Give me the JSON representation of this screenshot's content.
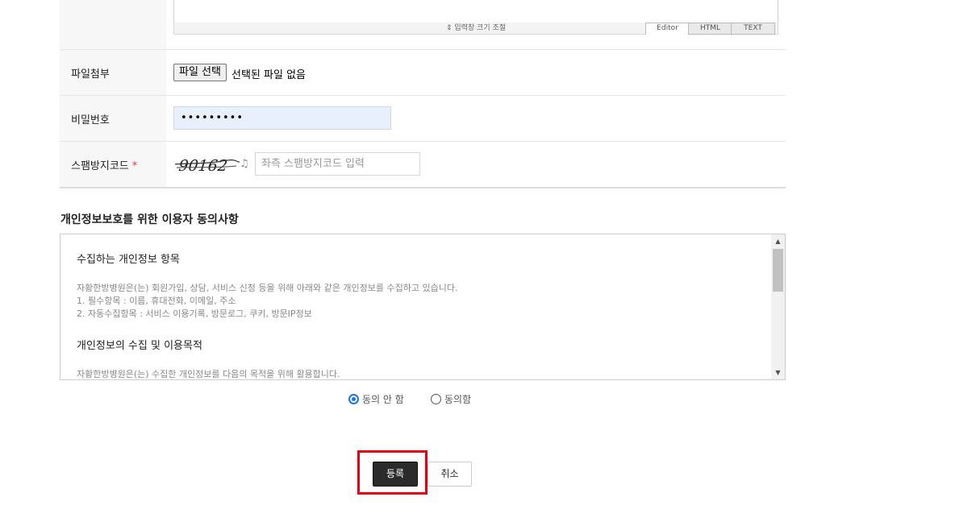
{
  "editor": {
    "resize_label": "⇕ 입력창 크기 조절",
    "tabs": [
      "Editor",
      "HTML",
      "TEXT"
    ]
  },
  "form": {
    "attachment": {
      "label": "파일첨부",
      "button": "파일 선택",
      "status": "선택된 파일 없음"
    },
    "password": {
      "label": "비밀번호",
      "value": "•••••••••"
    },
    "captcha": {
      "label": "스팸방지코드",
      "required_mark": "*",
      "code_image_text": "90162",
      "headset_icon": "♫",
      "placeholder": "좌측 스팸방지코드 입력"
    }
  },
  "privacy": {
    "title": "개인정보보호를 위한 이용자 동의사항",
    "sections": [
      {
        "heading": "수집하는 개인정보 항목",
        "lines": [
          "자황한방병원은(는) 회원가입, 상담, 서비스 신청 등을 위해 아래와 같은 개인정보를 수집하고 있습니다.",
          "1. 필수항목 : 이름, 휴대전화, 이메일, 주소",
          "2. 자동수집항목 : 서비스 이용기록, 방문로그, 쿠키, 방문IP정보"
        ]
      },
      {
        "heading": "개인정보의 수집 및 이용목적",
        "lines": [
          "자황한방병원은(는) 수집한 개인정보를 다음의 목적을 위해 활용합니다."
        ]
      }
    ],
    "options": {
      "disagree": "동의 안 함",
      "agree": "동의함"
    },
    "selected": "disagree"
  },
  "actions": {
    "submit": "등록",
    "cancel": "취소"
  },
  "colors": {
    "highlight": "#e60012",
    "primary_button": "#2b2b2b",
    "radio_checked": "#1a73e8",
    "required": "#e53935"
  }
}
